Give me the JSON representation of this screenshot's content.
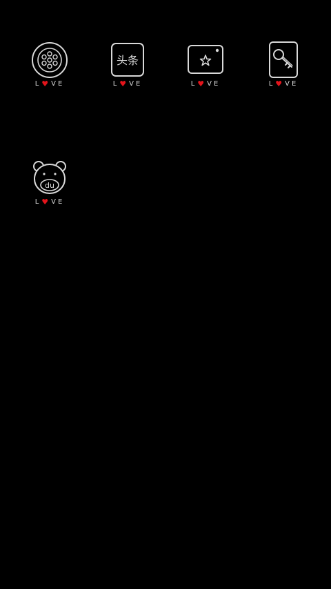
{
  "home_screen": {
    "background": "#000000",
    "icon_stroke_color": "#d9d9d9",
    "heart_color": "#e3141b",
    "apps": [
      {
        "icon": "film-reel-icon",
        "label": {
          "l": "L",
          "o": "♥",
          "v": "V",
          "e": "E"
        }
      },
      {
        "icon": "toutiao-icon",
        "icon_text": "头条",
        "label": {
          "l": "L",
          "o": "♥",
          "v": "V",
          "e": "E"
        }
      },
      {
        "icon": "camera-star-icon",
        "label": {
          "l": "L",
          "o": "♥",
          "v": "V",
          "e": "E"
        }
      },
      {
        "icon": "key-icon",
        "label": {
          "l": "L",
          "o": "♥",
          "v": "V",
          "e": "E"
        }
      },
      {
        "icon": "bear-du-icon",
        "icon_text": "du",
        "label": {
          "l": "L",
          "o": "♥",
          "v": "V",
          "e": "E"
        }
      }
    ]
  }
}
